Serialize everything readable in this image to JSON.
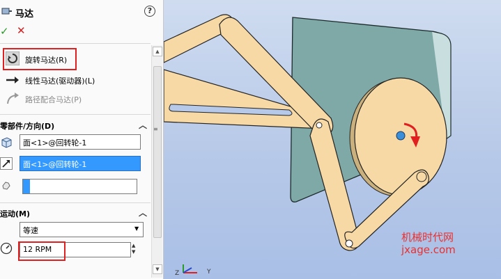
{
  "header": {
    "title": "马达",
    "help": "?"
  },
  "actions": {
    "ok": "✓",
    "cancel": "✕"
  },
  "motor_type": {
    "options": [
      {
        "label": "旋转马达(R)",
        "selected": true
      },
      {
        "label": "线性马达(驱动器)(L)",
        "selected": false
      },
      {
        "label": "路径配合马达(P)",
        "selected": false
      }
    ]
  },
  "component_direction": {
    "section_title": "零部件/方向(D)",
    "direction_value": "面<1>@回转轮-1",
    "location_value": "面<1>@回转轮-1",
    "component_value": ""
  },
  "motion": {
    "section_title": "运动(M)",
    "type_selected": "等速",
    "speed_value": "12 RPM"
  },
  "viewport": {
    "watermark_cn": "机械时代网",
    "watermark_url": "jxage.com",
    "triad_z": "Z",
    "triad_y": "Y"
  },
  "colors": {
    "highlight": "#3399ff",
    "callout": "#e02020",
    "part_fill": "#f7d9a6",
    "plate": "#7fa9a6"
  }
}
